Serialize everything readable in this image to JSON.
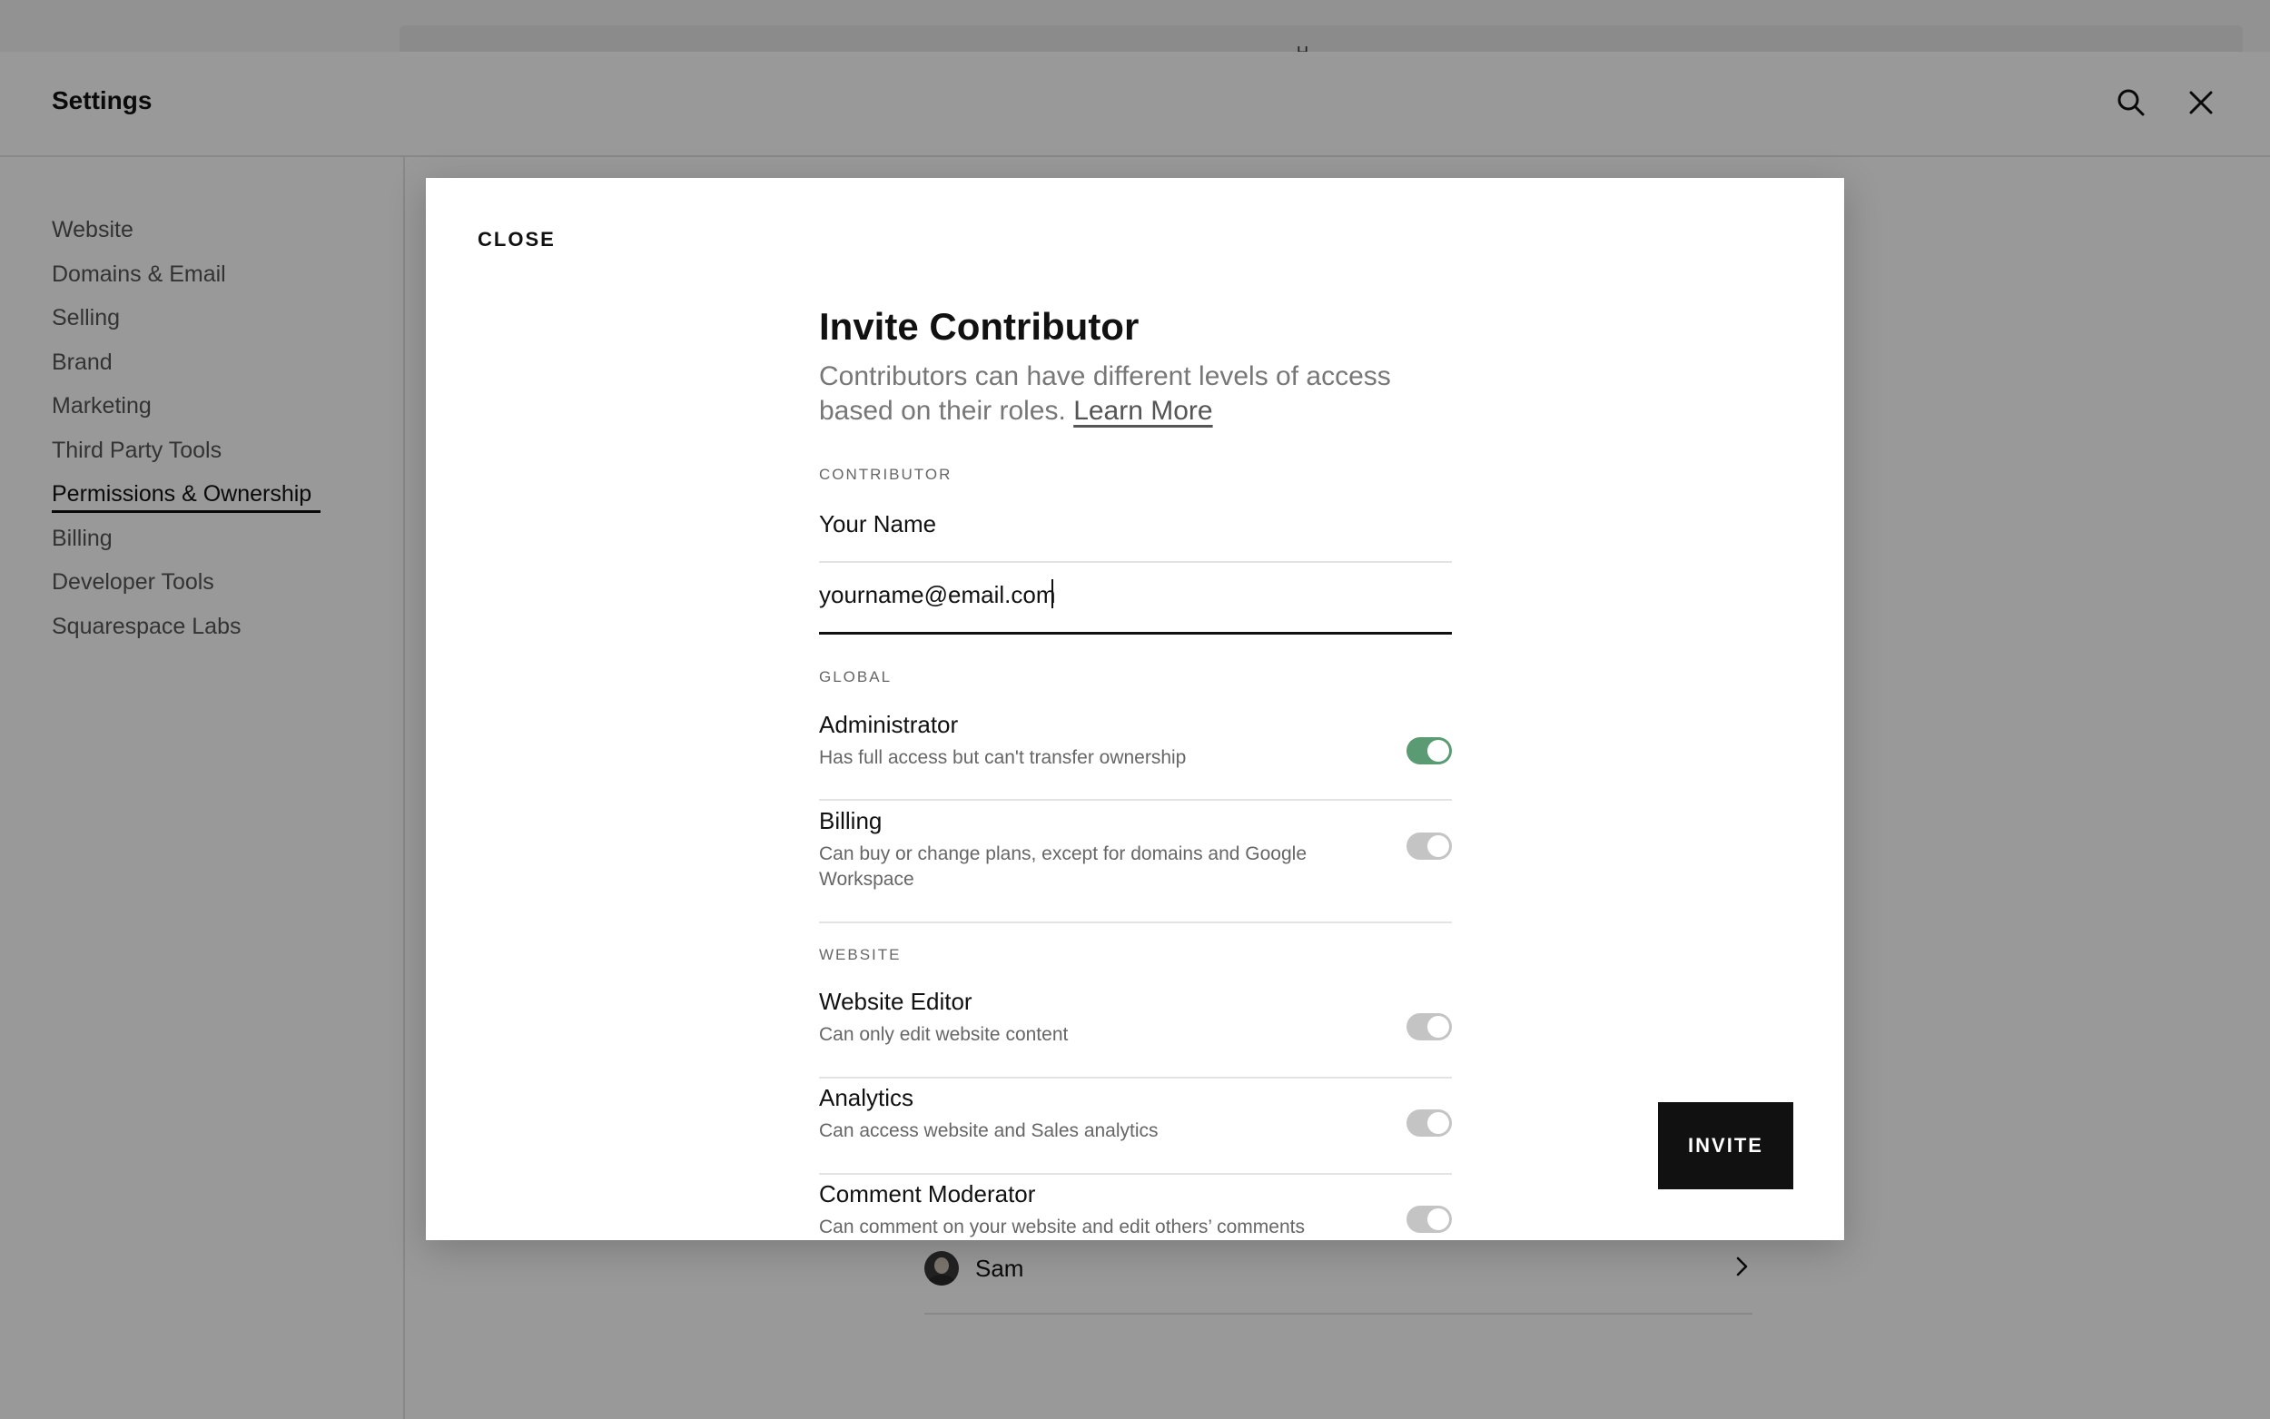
{
  "top_bar": {
    "ghost_glyph": "H"
  },
  "settings": {
    "title": "Settings",
    "search_icon": "search-icon",
    "close_icon": "close-icon"
  },
  "sidebar": {
    "items": [
      {
        "label": "Website"
      },
      {
        "label": "Domains & Email"
      },
      {
        "label": "Selling"
      },
      {
        "label": "Brand"
      },
      {
        "label": "Marketing"
      },
      {
        "label": "Third Party Tools"
      },
      {
        "label": "Permissions & Ownership",
        "active": true
      },
      {
        "label": "Billing"
      },
      {
        "label": "Developer Tools"
      },
      {
        "label": "Squarespace Labs"
      }
    ]
  },
  "background_list": {
    "user_name": "Sam",
    "chevron_icon": "chevron-right-icon"
  },
  "modal": {
    "close_label": "CLOSE",
    "title": "Invite Contributor",
    "description": "Contributors can have different levels of access based on their roles.",
    "learn_more": "Learn More",
    "contributor_section": "CONTRIBUTOR",
    "name_placeholder": "Your Name",
    "email_value": "yourname@email.com",
    "global_section": "GLOBAL",
    "website_section": "WEBSITE",
    "permissions": [
      {
        "name": "Administrator",
        "description": "Has full access but can't transfer ownership",
        "enabled": true
      },
      {
        "name": "Billing",
        "description": "Can buy or change plans, except for domains and Google Workspace",
        "enabled": false
      },
      {
        "name": "Website Editor",
        "description": "Can only edit website content",
        "enabled": false
      },
      {
        "name": "Analytics",
        "description": "Can access website and Sales analytics",
        "enabled": false
      },
      {
        "name": "Comment Moderator",
        "description": "Can comment on your website and edit others’ comments",
        "enabled": false
      }
    ],
    "invite_label": "INVITE"
  },
  "colors": {
    "toggle_on": "#5a9b74",
    "toggle_off": "#c4c4c4",
    "overlay": "rgba(0,0,0,0.40)"
  }
}
